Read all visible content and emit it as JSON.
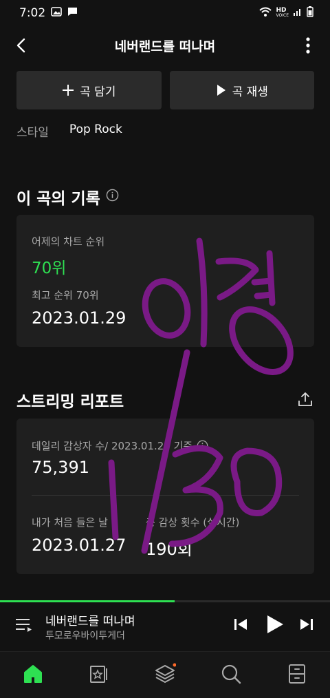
{
  "status_bar": {
    "time": "7:02",
    "network_label": "HD",
    "voice_label": "VOICE"
  },
  "header": {
    "title": "네버랜드를 떠나며"
  },
  "actions": {
    "add_label": "곡 담기",
    "play_label": "곡 재생"
  },
  "style": {
    "label": "스타일",
    "value": "Pop Rock"
  },
  "record_section": {
    "title": "이 곡의 기록",
    "chart_label": "어제의 차트 순위",
    "chart_rank": "70위",
    "best_label": "최고 순위 70위",
    "best_date": "2023.01.29"
  },
  "streaming_section": {
    "title": "스트리밍 리포트",
    "daily_label": "데일리 감상자 수/ 2023.01.29 기준",
    "daily_value": "75,391",
    "first_listen_label": "내가 처음 들은 날",
    "first_listen_value": "2023.01.27",
    "total_plays_label": "총 감상 횟수 (실시간)",
    "total_plays_value": "190회"
  },
  "player": {
    "track_title": "네버랜드를 떠나며",
    "artist": "투모로우바이투게더",
    "progress": 0.53
  },
  "handwriting": {
    "text_top": "이경",
    "text_bottom": "1/30",
    "color": "#7a1a86"
  },
  "colors": {
    "accent": "#2ee052",
    "background": "#121212",
    "card": "#1f1f1f"
  },
  "nav": {
    "items": [
      {
        "icon": "home-icon",
        "active": true
      },
      {
        "icon": "library-card-icon"
      },
      {
        "icon": "layers-icon"
      },
      {
        "icon": "search-icon"
      },
      {
        "icon": "drawer-icon"
      }
    ]
  }
}
